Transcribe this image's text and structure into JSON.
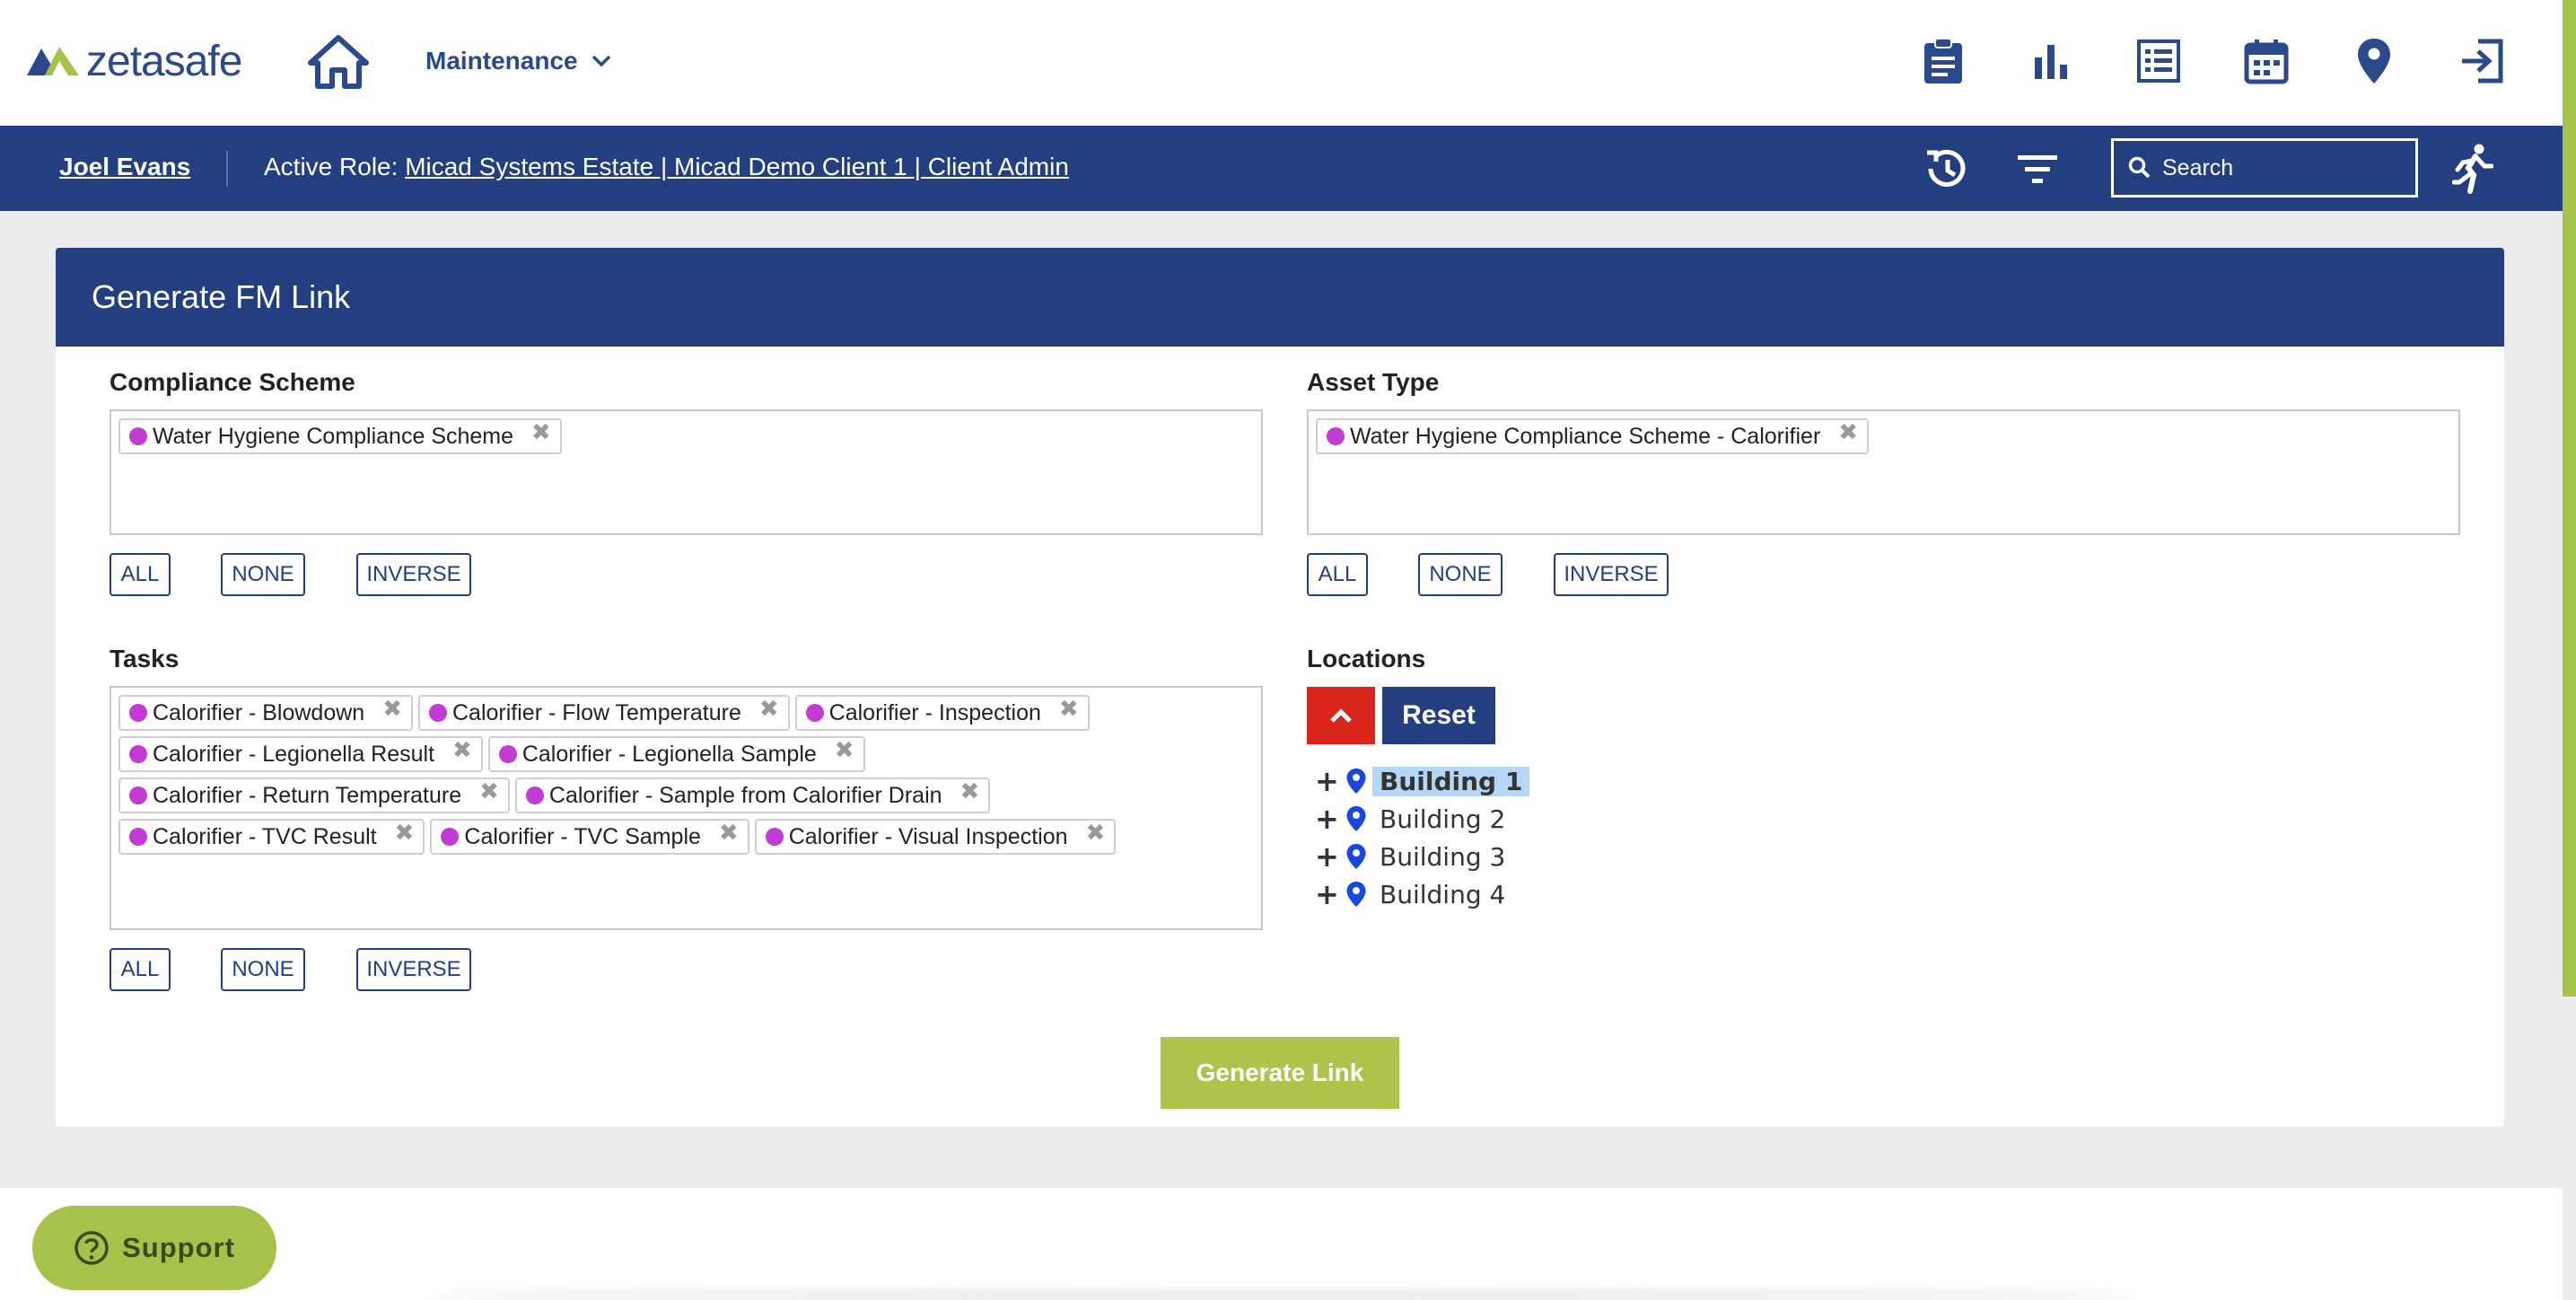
{
  "brand": {
    "name": "zetasafe"
  },
  "nav": {
    "menu_label": "Maintenance"
  },
  "top_icons": [
    "clipboard-icon",
    "bar-chart-icon",
    "list-icon",
    "calendar-icon",
    "map-pin-icon",
    "logout-icon"
  ],
  "userbar": {
    "user_name": "Joel Evans",
    "role_prefix": "Active Role:",
    "role_value": "Micad Systems Estate | Micad Demo Client 1 | Client Admin",
    "search_placeholder": "Search"
  },
  "card": {
    "title": "Generate FM Link",
    "compliance": {
      "label": "Compliance Scheme",
      "tags": [
        "Water Hygiene Compliance Scheme"
      ]
    },
    "asset_type": {
      "label": "Asset Type",
      "tags": [
        "Water Hygiene Compliance Scheme - Calorifier"
      ]
    },
    "tasks": {
      "label": "Tasks",
      "tags": [
        "Calorifier - Blowdown",
        "Calorifier - Flow Temperature",
        "Calorifier - Inspection",
        "Calorifier - Legionella Result",
        "Calorifier - Legionella Sample",
        "Calorifier - Return Temperature",
        "Calorifier - Sample from Calorifier Drain",
        "Calorifier - TVC Result",
        "Calorifier - TVC Sample",
        "Calorifier - Visual Inspection"
      ]
    },
    "select_buttons": {
      "all": "ALL",
      "none": "NONE",
      "inverse": "INVERSE"
    },
    "locations": {
      "label": "Locations",
      "reset_label": "Reset",
      "items": [
        {
          "label": "Building 1",
          "selected": true
        },
        {
          "label": "Building 2",
          "selected": false
        },
        {
          "label": "Building 3",
          "selected": false
        },
        {
          "label": "Building 4",
          "selected": false
        }
      ]
    },
    "generate_label": "Generate Link"
  },
  "support": {
    "label": "Support"
  },
  "colors": {
    "navy": "#233f7f",
    "brand_green": "#a6c24a",
    "tag_dot": "#c23bd4",
    "collapse_red": "#d9251c",
    "selected_highlight": "#b4d7f5"
  }
}
